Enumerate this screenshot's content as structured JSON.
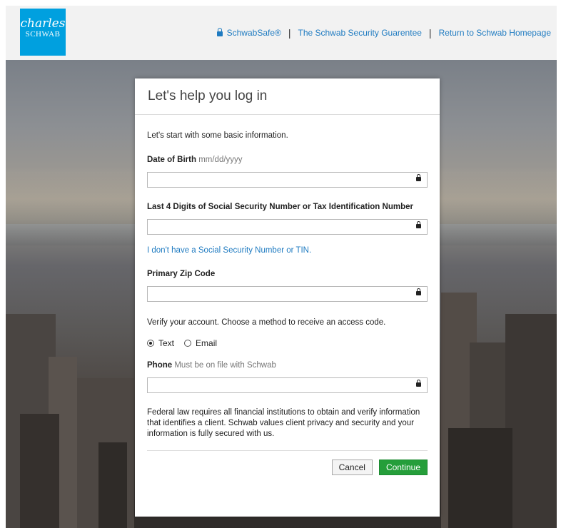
{
  "header": {
    "logo_script": "charles",
    "logo_caps": "SCHWAB",
    "nav": {
      "schwabsafe": "SchwabSafe®",
      "guarantee": "The Schwab Security Guarentee",
      "home": "Return to Schwab Homepage"
    }
  },
  "modal": {
    "title": "Let's help you log in",
    "intro": "Let's start with some basic information.",
    "dob_label": "Date of Birth",
    "dob_hint": "mm/dd/yyyy",
    "ssn_label": "Last 4 Digits of Social Security Number or Tax Identification Number",
    "no_ssn_link": "I don't have a Social Security Number or TIN.",
    "zip_label": "Primary Zip Code",
    "verify_text": "Verify your account. Choose a method to receive an access code.",
    "radio_text": "Text",
    "radio_email": "Email",
    "selected_method": "Text",
    "phone_label": "Phone",
    "phone_hint": "Must be on file with Schwab",
    "legal": "Federal law requires all financial institutions to obtain and verify information that identifies a client. Schwab values client privacy and security and your information is fully secured with us.",
    "cancel": "Cancel",
    "continue": "Continue"
  },
  "colors": {
    "brand_blue": "#00a0df",
    "link_blue": "#1f7bc1",
    "continue_green": "#259e3a"
  }
}
